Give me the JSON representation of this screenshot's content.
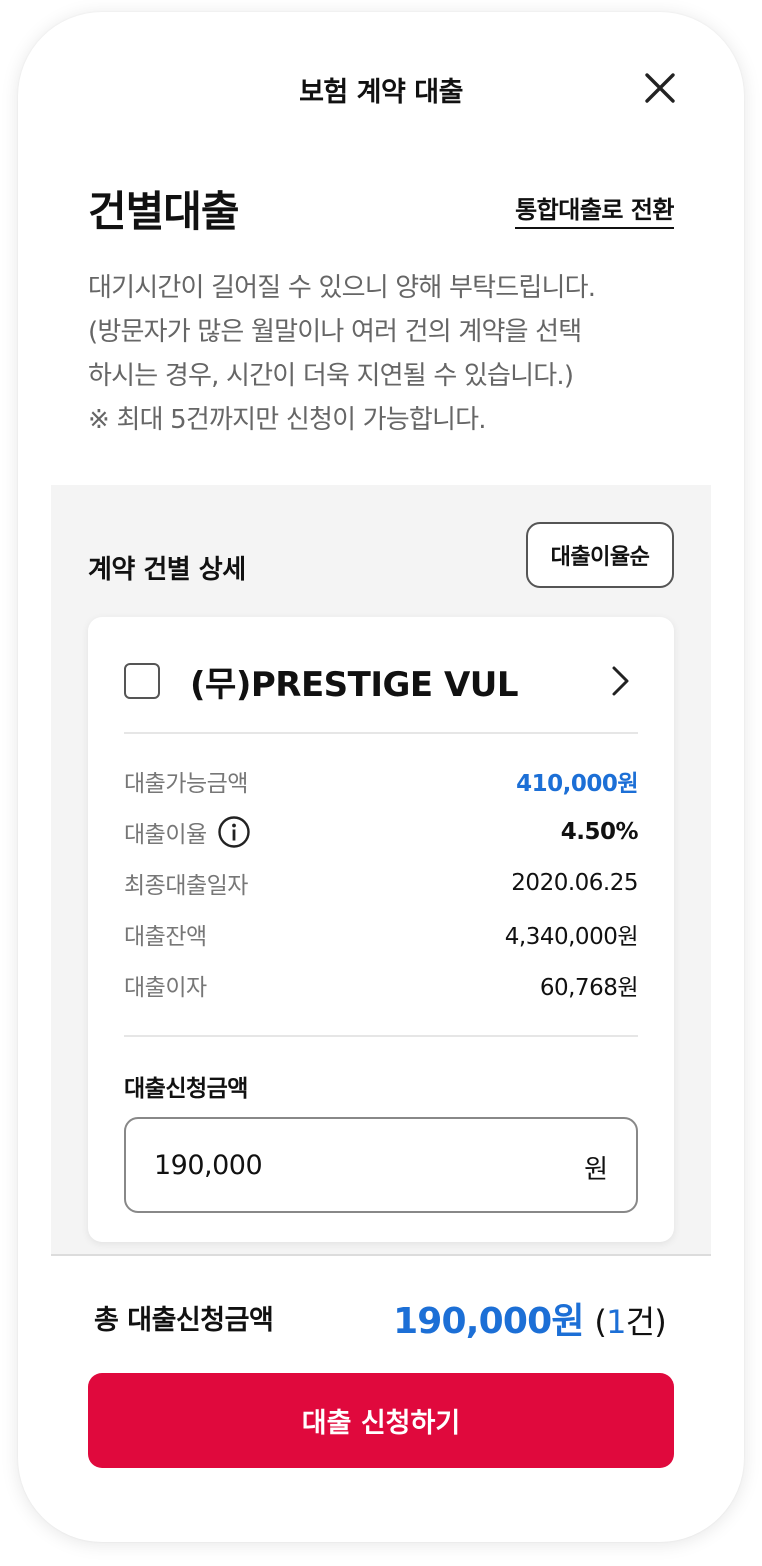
{
  "header": {
    "title": "보험 계약 대출",
    "close_icon": "close-icon"
  },
  "page": {
    "title": "건별대출",
    "switch_link": "통합대출로 전환",
    "notice_lines": [
      "대기시간이 길어질 수 있으니 양해 부탁드립니다.",
      "(방문자가 많은 월말이나 여러 건의 계약을 선택",
      "하시는 경우, 시간이 더욱 지연될 수 있습니다.)",
      "※ 최대 5건까지만 신청이 가능합니다."
    ]
  },
  "detail": {
    "title": "계약 건별 상세",
    "sort_label": "대출이율순",
    "contract": {
      "name": "(무)PRESTIGE VUL",
      "checked": false,
      "rows": [
        {
          "label": "대출가능금액",
          "value": "410,000원"
        },
        {
          "label": "대출이율",
          "value": "4.50%"
        },
        {
          "label": "최종대출일자",
          "value": "2020.06.25"
        },
        {
          "label": "대출잔액",
          "value": "4,340,000원"
        },
        {
          "label": "대출이자",
          "value": "60,768원"
        }
      ],
      "apply_label": "대출신청금액",
      "apply_amount": "190,000",
      "apply_unit": "원"
    }
  },
  "footer": {
    "total_label": "총 대출신청금액",
    "total_amount": "190,000원",
    "paren_open": "(",
    "count": "1",
    "count_unit": "건)",
    "submit_label": "대출 신청하기"
  },
  "colors": {
    "accent_blue": "#1c6fd6",
    "primary_red": "#e0093d"
  }
}
